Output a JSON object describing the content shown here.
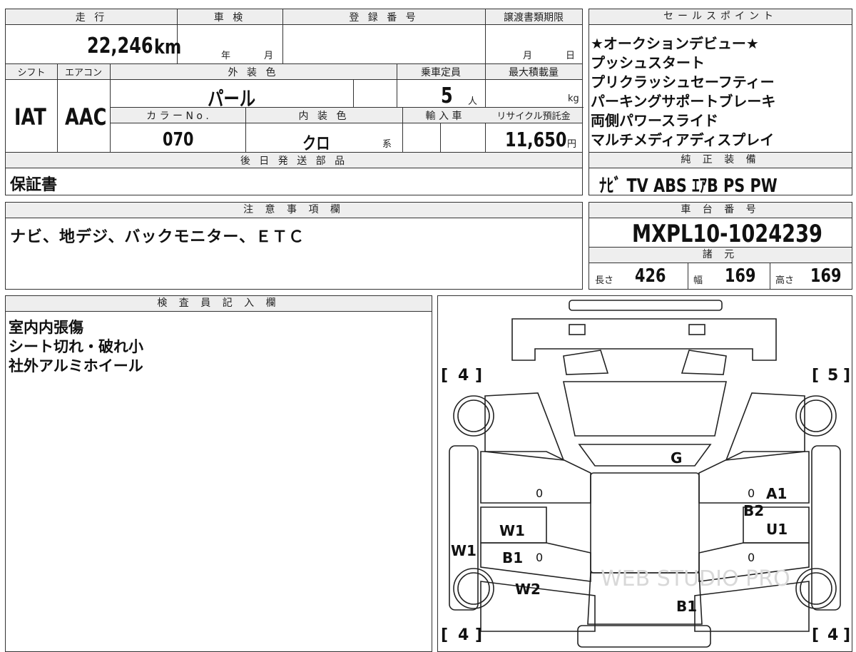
{
  "top_header": {
    "mileage_label": "走 行",
    "inspection_label": "車 検",
    "registration_label": "登 録 番 号",
    "transfer_deadline_label": "譲渡書類期限",
    "sales_points_label": "セールスポイント"
  },
  "mileage": {
    "value": "22,246",
    "unit": "km"
  },
  "inspection": {
    "year_unit": "年",
    "month_unit": "月"
  },
  "transfer_deadline": {
    "month_unit": "月",
    "day_unit": "日"
  },
  "labels_row2": {
    "shift": "シフト",
    "aircon": "エアコン",
    "exterior_color": "外 装 色",
    "capacity": "乗車定員",
    "max_load": "最大積載量",
    "color_no": "カ ラ ー N o .",
    "interior_color": "内 装 色",
    "import": "輸 入 車",
    "recycle_fee": "リサイクル預託金"
  },
  "values": {
    "shift": "IAT",
    "aircon": "AAC",
    "exterior_color": "パール",
    "capacity": "5",
    "capacity_unit": "人",
    "max_load_unit": "kg",
    "color_no": "070",
    "interior_color": "クロ",
    "interior_suffix": "系",
    "recycle_fee": "11,650",
    "recycle_unit": "円"
  },
  "sales_points": [
    "★オークションデビュー★",
    "プッシュスタート",
    "プリクラッシュセーフティー",
    "パーキングサポートブレーキ",
    "両側パワースライド",
    "マルチメディアディスプレイ"
  ],
  "later_parts": {
    "label": "後 日 発 送 部 品",
    "value": "保証書"
  },
  "genuine_equipment": {
    "label": "純 正 装 備",
    "value": "ﾅﾋﾞ TV ABS ｴｱB PS PW"
  },
  "notes": {
    "label": "注 意 事 項 欄",
    "value": "ナビ、地デジ、バックモニター、ＥＴＣ"
  },
  "chassis": {
    "label": "車 台 番 号",
    "value": "MXPL10-1024239"
  },
  "specs": {
    "label": "諸 元",
    "length_label": "長さ",
    "length": "426",
    "width_label": "幅",
    "width": "169",
    "height_label": "高さ",
    "height": "169"
  },
  "inspector": {
    "label": "検 査 員 記 入 欄",
    "lines": [
      "室内内張傷",
      "シート切れ・破れ小",
      "社外アルミホイール"
    ]
  },
  "diagram": {
    "tire_fl": "4",
    "tire_fr": "5",
    "tire_rl": "4",
    "tire_rr": "4",
    "marks": {
      "g": "G",
      "a1": "A1",
      "b2": "B2",
      "u1": "U1",
      "w1_door": "W1",
      "b1_door": "B1",
      "w1_side": "W1",
      "w2": "W2",
      "b1_rear": "B1",
      "zero1": "0",
      "zero2": "0",
      "zero3": "0",
      "zero4": "0"
    },
    "watermark": "WEB STUDIO PRO"
  }
}
